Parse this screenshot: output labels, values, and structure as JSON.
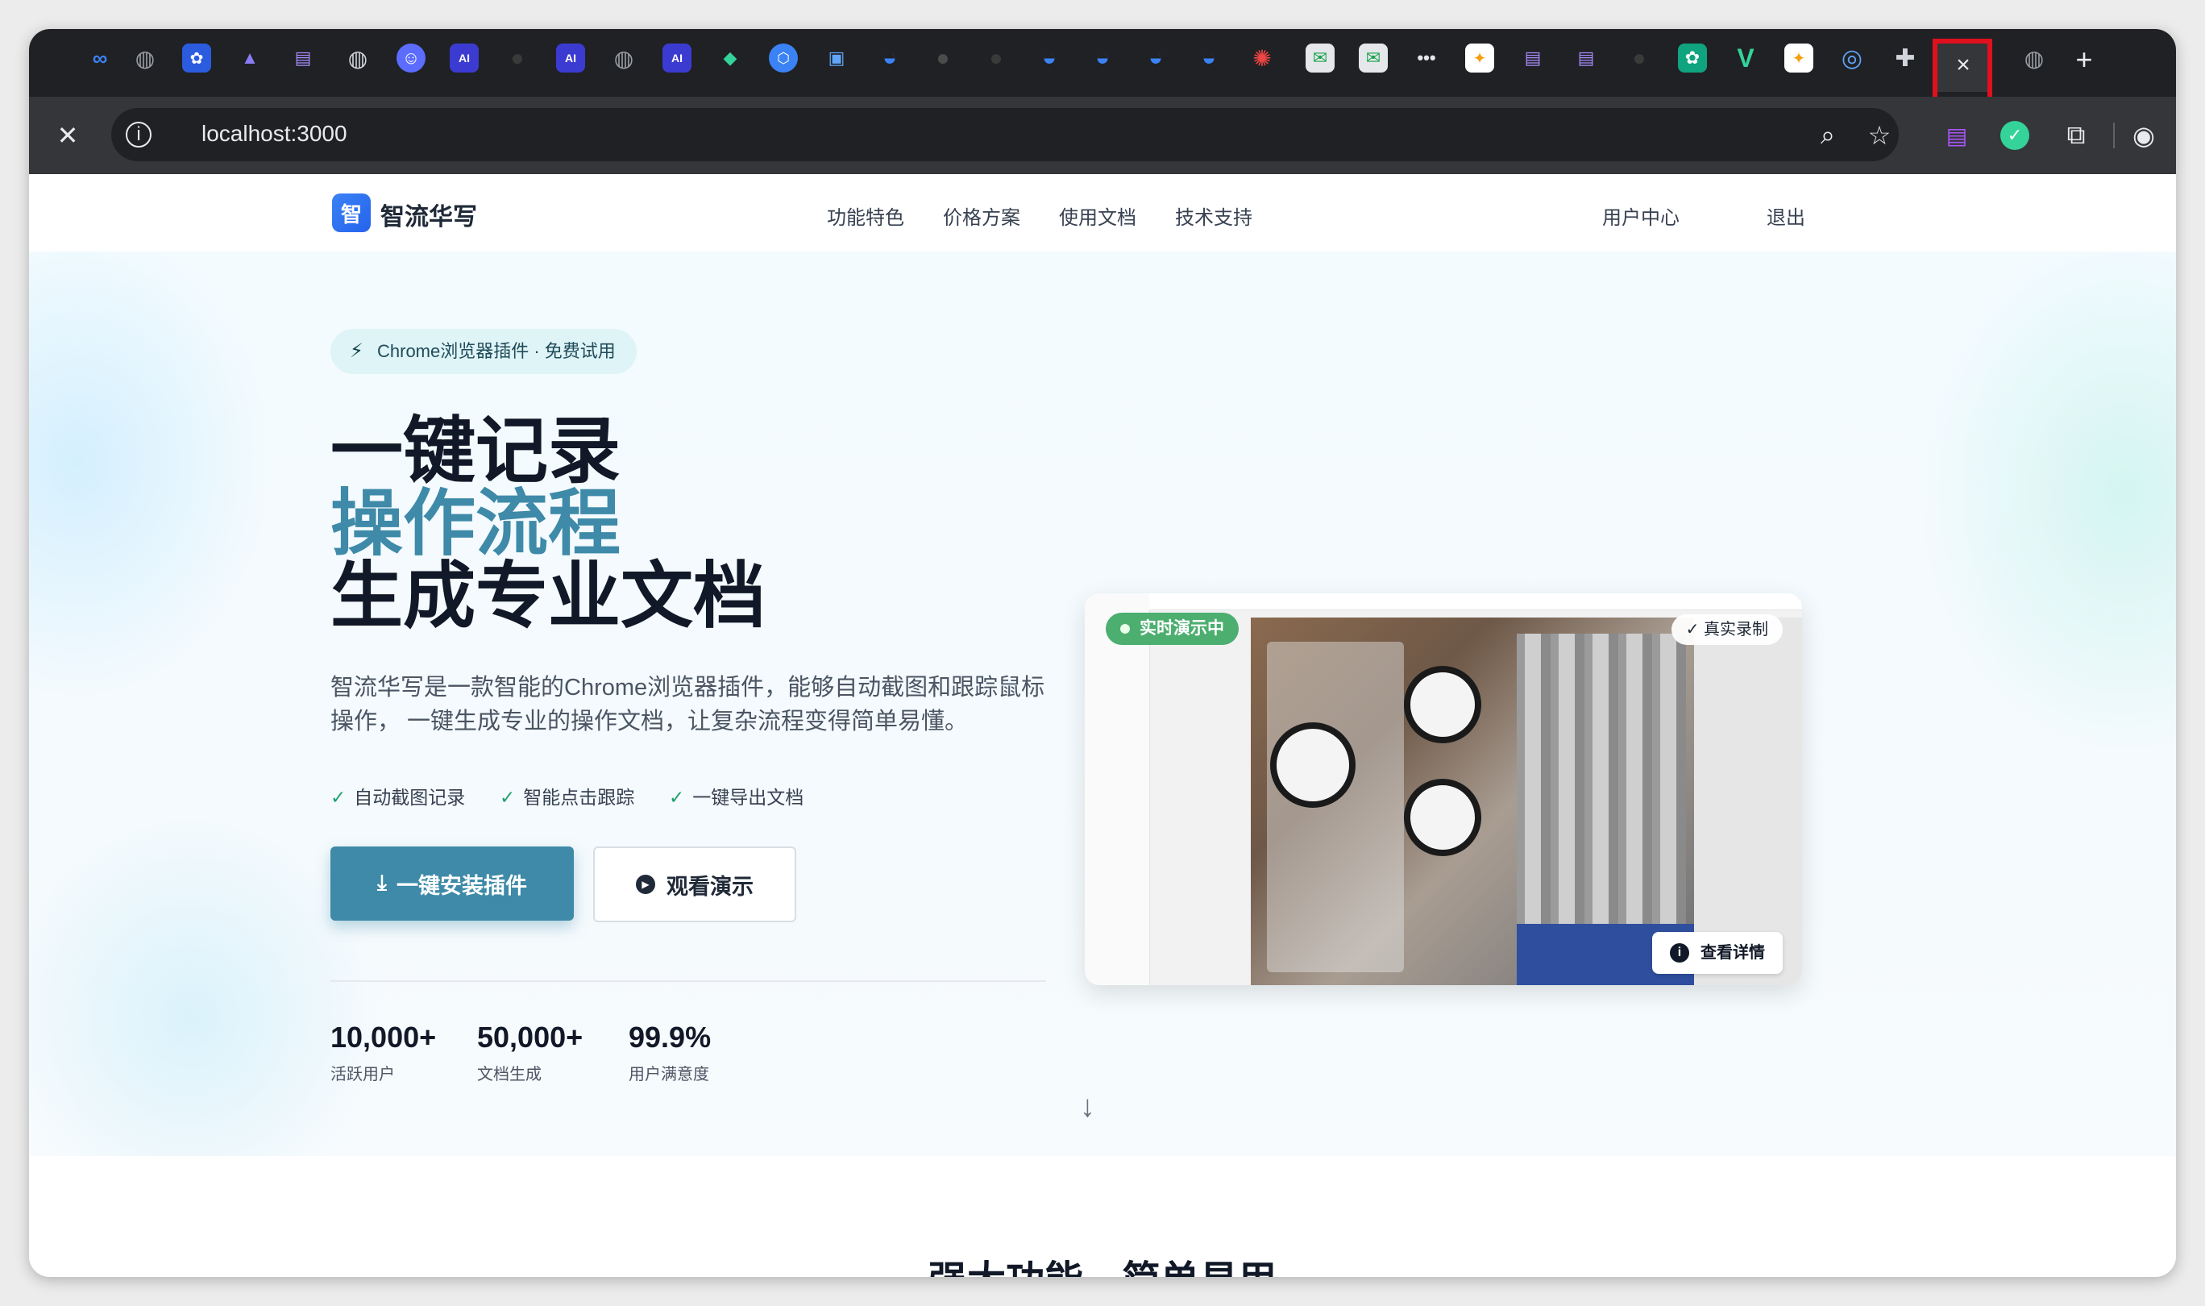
{
  "browser": {
    "address": "localhost:3000",
    "active_tab_close_glyph": "×",
    "new_tab_glyph": "+",
    "tab_icons": [
      "meta-icon",
      "globe-icon",
      "baidu-icon",
      "wings-icon",
      "doc-icon",
      "globe-icon",
      "bot-icon",
      "ai-icon",
      "github-icon",
      "ai-icon",
      "globe-icon",
      "ai-icon",
      "stack-icon",
      "hex-icon",
      "tv-icon",
      "edge-icon",
      "github-icon",
      "github-icon",
      "edge-icon",
      "edge-icon",
      "edge-icon",
      "edge-icon",
      "octopus-icon",
      "mail-icon",
      "mail-icon",
      "dots-icon",
      "image-icon",
      "doc-icon",
      "doc-icon",
      "github-icon",
      "openai-icon",
      "vue-icon",
      "image-icon",
      "circle-icon",
      "puzzle-icon"
    ]
  },
  "site": {
    "logo_char": "智",
    "brand": "智流华写",
    "nav": [
      "功能特色",
      "价格方案",
      "使用文档",
      "技术支持"
    ],
    "user_center": "用户中心",
    "logout": "退出"
  },
  "hero": {
    "badge": "Chrome浏览器插件 · 免费试用",
    "line1": "一键记录",
    "line2": "操作流程",
    "line3": "生成专业文档",
    "description": "智流华写是一款智能的Chrome浏览器插件，能够自动截图和跟踪鼠标操作， 一键生成专业的操作文档，让复杂流程变得简单易懂。",
    "features": [
      "自动截图记录",
      "智能点击跟踪",
      "一键导出文档"
    ],
    "primary_button": "一键安装插件",
    "secondary_button": "观看演示",
    "stats": [
      {
        "value": "10,000+",
        "label": "活跃用户"
      },
      {
        "value": "50,000+",
        "label": "文档生成"
      },
      {
        "value": "99.9%",
        "label": "用户满意度"
      }
    ],
    "demo": {
      "live_label": "实时演示中",
      "real_label": "✓ 真实录制",
      "detail_button": "查看详情"
    },
    "accent_color": "#3e8aa8"
  },
  "next_section": {
    "title": "强大功能，简单易用"
  }
}
